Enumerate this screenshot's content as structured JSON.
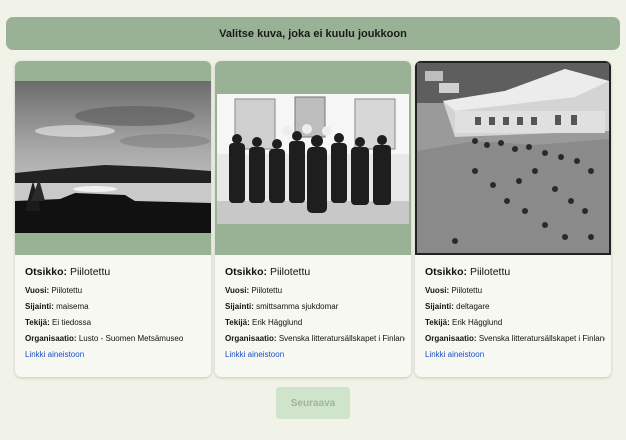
{
  "header": {
    "prompt": "Valitse kuva, joka ei kuulu joukkoon"
  },
  "labels": {
    "title": "Otsikko:",
    "year": "Vuosi:",
    "location": "Sijainti:",
    "author": "Tekijä:",
    "organization": "Organisaatio:"
  },
  "cards": [
    {
      "image_icon": "landscape-photo",
      "title": "Piilotettu",
      "year": "Piilotettu",
      "location": "maisema",
      "author": "Ei tiedossa",
      "organization": "Lusto - Suomen Metsämuseo",
      "link": "Linkki aineistoon"
    },
    {
      "image_icon": "group-photo",
      "title": "Piilotettu",
      "year": "Piilotettu",
      "location": "smittsamma sjukdomar",
      "author": "Erik Hägglund",
      "organization": "Svenska litteratursällskapet i Finland",
      "link": "Linkki aineistoon"
    },
    {
      "image_icon": "crowd-photo",
      "title": "Piilotettu",
      "year": "Piilotettu",
      "location": "deltagare",
      "author": "Erik Hägglund",
      "organization": "Svenska litteratursällskapet i Finland",
      "link": "Linkki aineistoon"
    }
  ],
  "footer": {
    "next_label": "Seuraava"
  }
}
